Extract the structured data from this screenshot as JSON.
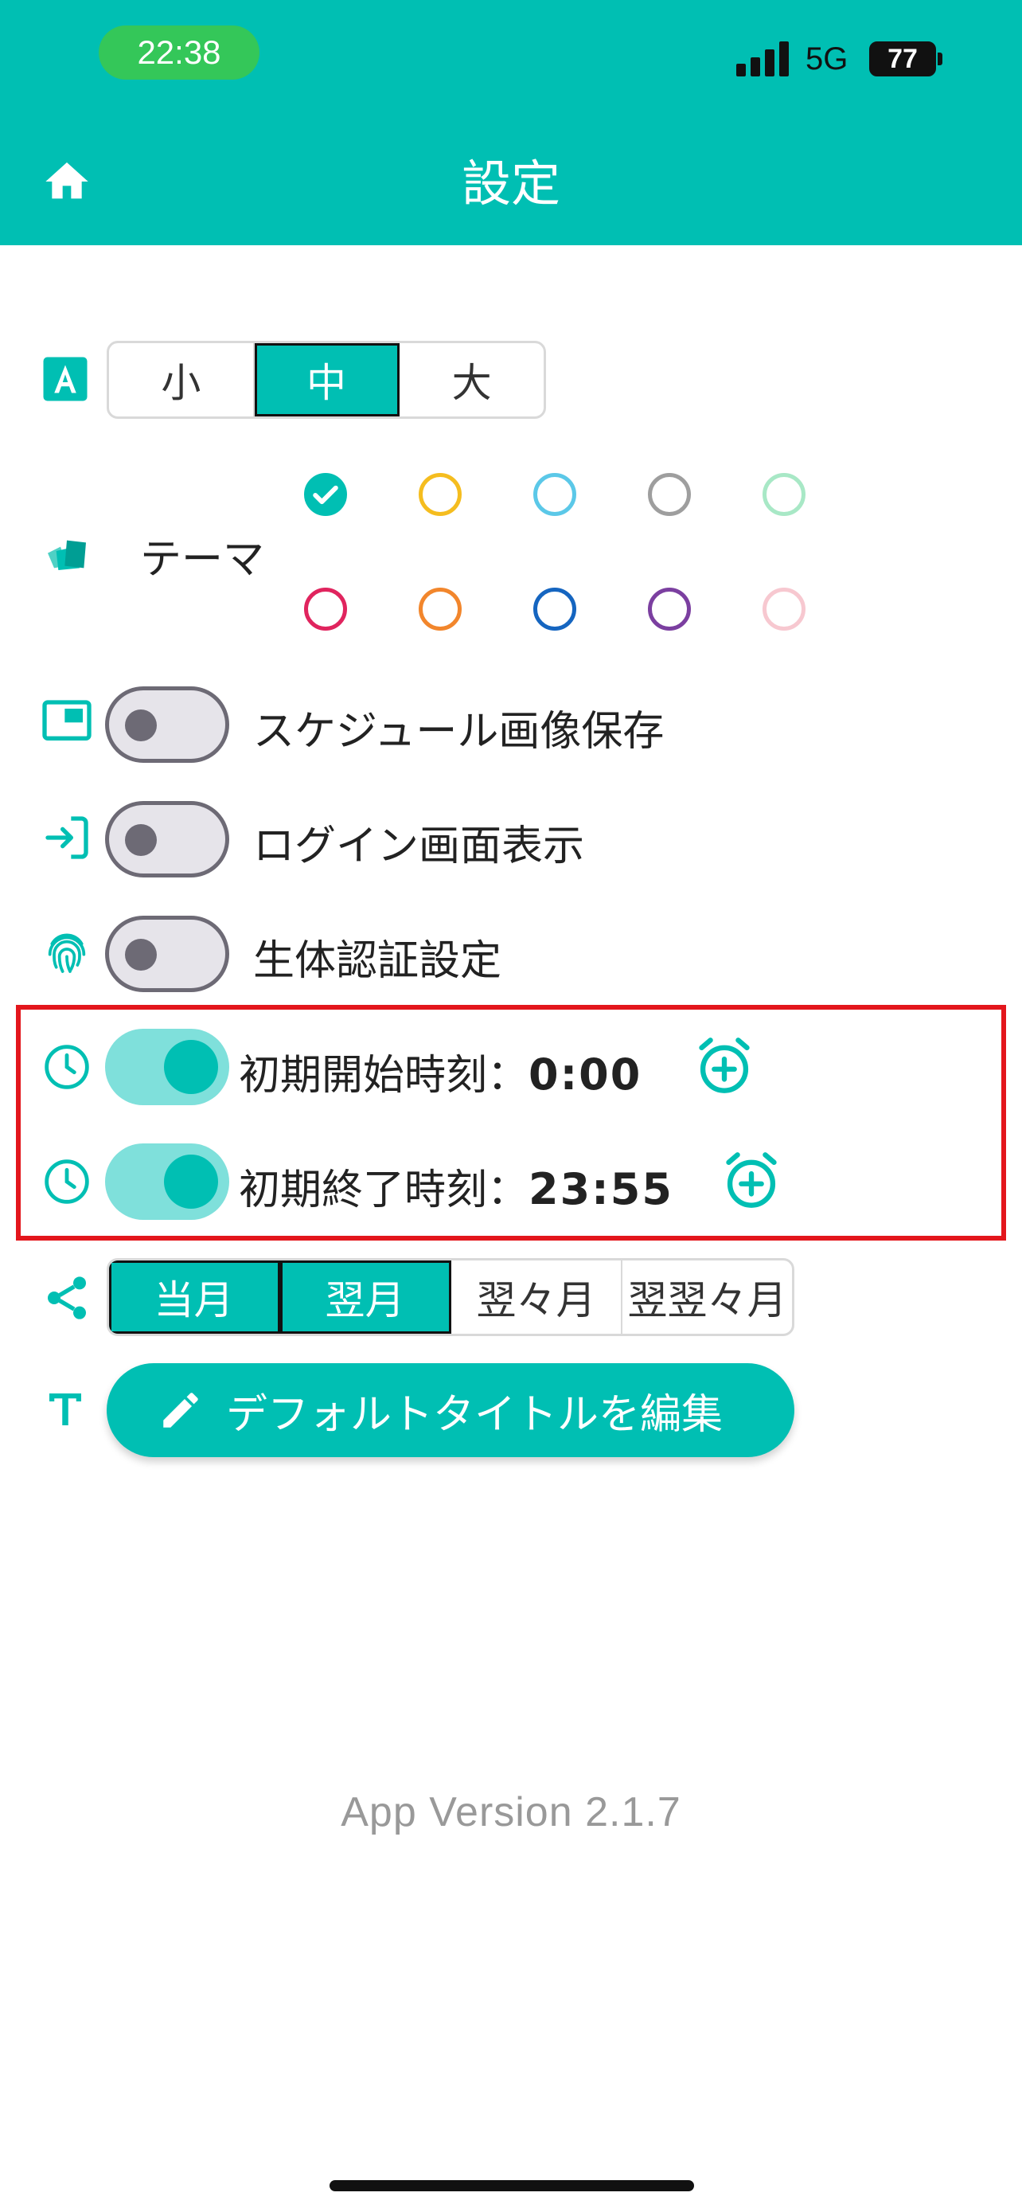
{
  "status_bar": {
    "time": "22:38",
    "network": "5G",
    "battery": "77"
  },
  "header": {
    "title": "設定"
  },
  "font_size": {
    "options": [
      "小",
      "中",
      "大"
    ],
    "selected": "中"
  },
  "theme": {
    "label": "テーマ",
    "selected_index": 0,
    "colors": [
      "#00bfb3",
      "#f5bd1f",
      "#5bc8e8",
      "#9e9e9e",
      "#a8e8c6",
      "#e0245e",
      "#f2862c",
      "#1565c0",
      "#7b3fa0",
      "#f7c8d0"
    ]
  },
  "settings": {
    "schedule_image_save": {
      "label": "スケジュール画像保存",
      "enabled": false
    },
    "login_screen": {
      "label": "ログイン画面表示",
      "enabled": false
    },
    "biometric": {
      "label": "生体認証設定",
      "enabled": false
    },
    "start_time": {
      "label": "初期開始時刻：",
      "value": "0:00",
      "enabled": true
    },
    "end_time": {
      "label": "初期終了時刻：",
      "value": "23:55",
      "enabled": true
    }
  },
  "share_month": {
    "options": [
      "当月",
      "翌月",
      "翌々月",
      "翌翌々月"
    ],
    "selected": [
      "当月",
      "翌月"
    ]
  },
  "title_button": {
    "label": "デフォルトタイトルを編集"
  },
  "footer": {
    "version": "App Version 2.1.7"
  },
  "accent_color": "#00bfb3",
  "highlight_color": "#e3161c"
}
